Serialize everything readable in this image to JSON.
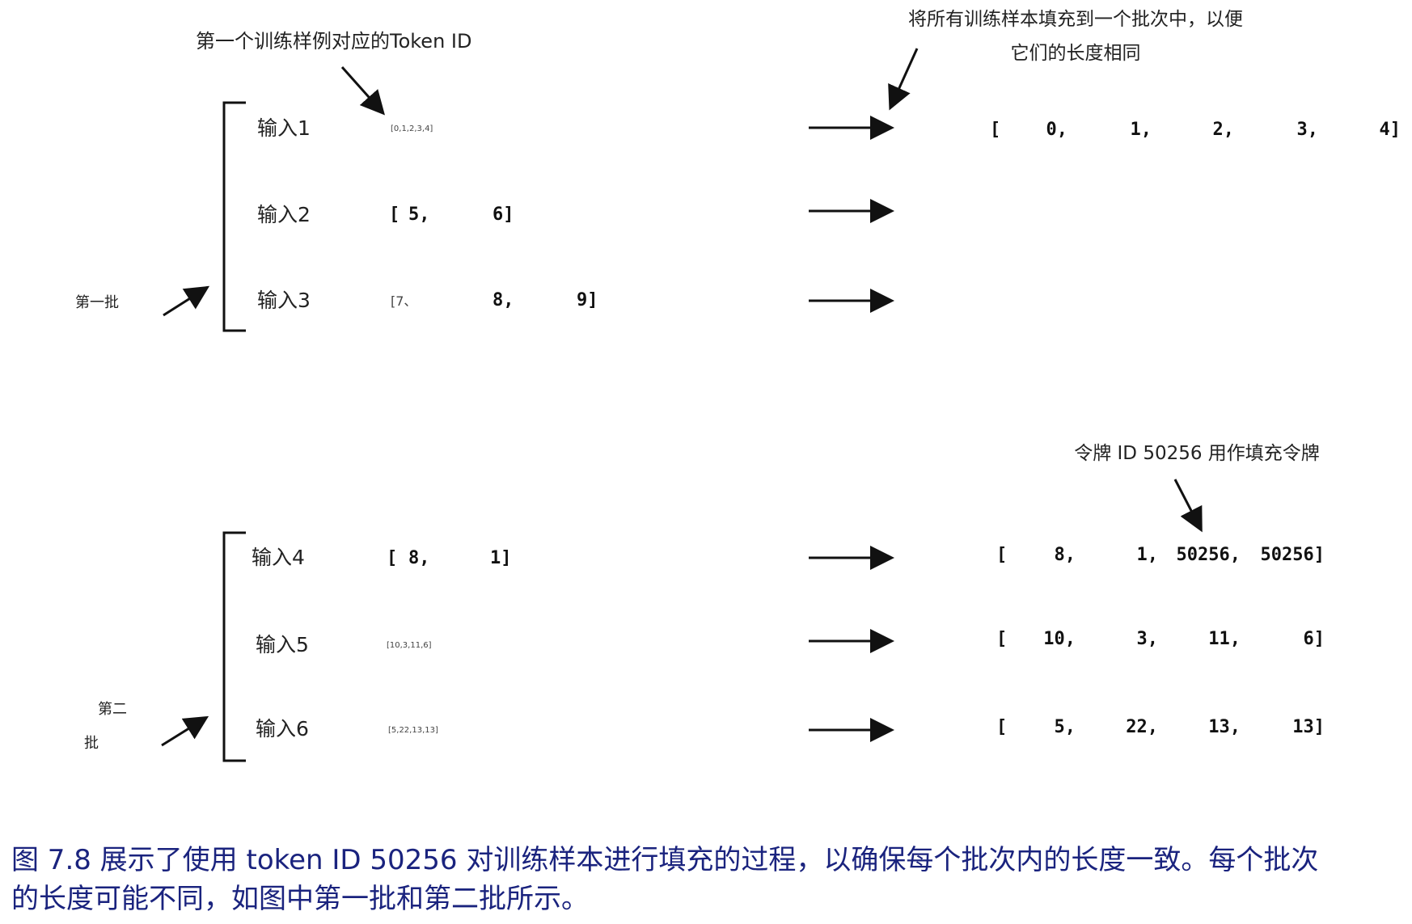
{
  "annotations": {
    "first_example": "第一个训练样例对应的Token ID",
    "pad_line1": "将所有训练样本填充到一个批次中，以便",
    "pad_line2": "它们的长度相同",
    "pad_token": "令牌 ID 50256 用作填充令牌"
  },
  "batches": [
    {
      "label_parts": [
        "第一批"
      ],
      "inputs": [
        {
          "label": "输入1",
          "raw": "[0,1,2,3,4]",
          "raw_style": "tiny",
          "padded": [
            "[",
            "0,",
            "1,",
            "2,",
            "3,",
            "4]"
          ]
        },
        {
          "label": "输入2",
          "raw_tokens": [
            "[",
            "5,",
            "6]"
          ],
          "raw_style": "mono",
          "padded": []
        },
        {
          "label": "输入3",
          "raw_mixed": [
            "[7、",
            "8,",
            "9]"
          ],
          "raw_style": "mixed",
          "padded": []
        }
      ]
    },
    {
      "label_parts": [
        "第二",
        "批"
      ],
      "inputs": [
        {
          "label": "输入4",
          "raw_tokens": [
            "[",
            "8,",
            "1]"
          ],
          "raw_style": "mono",
          "padded": [
            "[",
            "8,",
            "1,",
            "50256,",
            "50256]"
          ]
        },
        {
          "label": "输入5",
          "raw": "[10,3,11,6]",
          "raw_style": "tiny",
          "padded": [
            "[",
            "10,",
            "3,",
            "11,",
            "6]"
          ]
        },
        {
          "label": "输入6",
          "raw": "[5,22,13,13]",
          "raw_style": "tiny",
          "padded": [
            "[",
            "5,",
            "22,",
            "13,",
            "13]"
          ]
        }
      ]
    }
  ],
  "caption": {
    "line1": "图 7.8 展示了使用 token ID 50256 对训练样本进行填充的过程，以确保每个批次内的长度一致。每个批次",
    "line2": "的长度可能不同，如图中第一批和第二批所示。"
  },
  "colors": {
    "caption": "#1a237e",
    "lines": "#111111"
  }
}
